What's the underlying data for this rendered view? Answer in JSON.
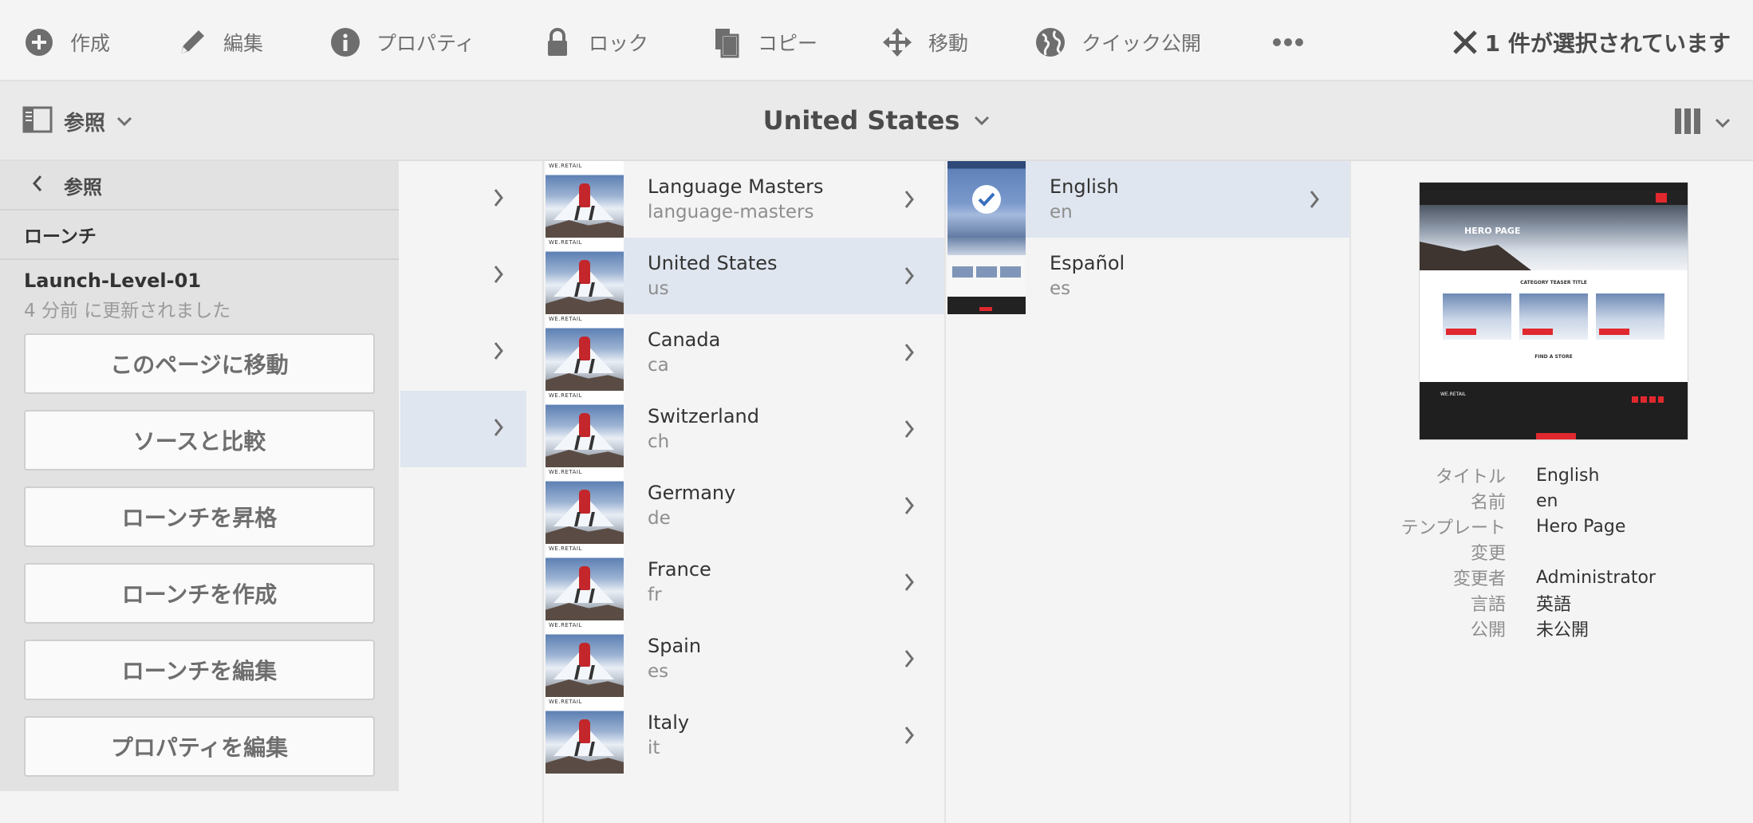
{
  "actionbar": {
    "actions": [
      {
        "label": "作成",
        "icon": "add-circle-icon"
      },
      {
        "label": "編集",
        "icon": "pencil-icon"
      },
      {
        "label": "プロパティ",
        "icon": "info-icon"
      },
      {
        "label": "ロック",
        "icon": "lock-icon"
      },
      {
        "label": "コピー",
        "icon": "copy-icon"
      },
      {
        "label": "移動",
        "icon": "move-icon"
      },
      {
        "label": "クイック公開",
        "icon": "globe-icon"
      },
      {
        "label": "",
        "icon": "more-icon"
      }
    ],
    "selection_text": "1 件が選択されています"
  },
  "subbar": {
    "rail_label": "参照",
    "title": "United States"
  },
  "rail": {
    "back_label": "参照",
    "section": "ローンチ",
    "launch_name": "Launch-Level-01",
    "launch_updated": "4 分前 に更新されました",
    "buttons": [
      "このページに移動",
      "ソースと比較",
      "ローンチを昇格",
      "ローンチを作成",
      "ローンチを編集",
      "プロパティを編集"
    ]
  },
  "column2": {
    "items": [
      {
        "title": "Language Masters",
        "name": "language-masters"
      },
      {
        "title": "United States",
        "name": "us",
        "selected": true
      },
      {
        "title": "Canada",
        "name": "ca"
      },
      {
        "title": "Switzerland",
        "name": "ch"
      },
      {
        "title": "Germany",
        "name": "de"
      },
      {
        "title": "France",
        "name": "fr"
      },
      {
        "title": "Spain",
        "name": "es"
      },
      {
        "title": "Italy",
        "name": "it"
      }
    ],
    "thumb_brand": "WE.RETAIL"
  },
  "column3": {
    "items": [
      {
        "title": "English",
        "name": "en",
        "selected": true
      },
      {
        "title": "Español",
        "name": "es"
      }
    ]
  },
  "preview": {
    "hero_text": "HERO PAGE",
    "category_text": "CATEGORY TEASER TITLE",
    "store_text": "FIND A STORE",
    "footer_brand": "WE.RETAIL",
    "meta": [
      {
        "key": "タイトル",
        "value": "English"
      },
      {
        "key": "名前",
        "value": "en"
      },
      {
        "key": "テンプレート",
        "value": "Hero Page"
      },
      {
        "key": "変更",
        "value": ""
      },
      {
        "key": "変更者",
        "value": "Administrator"
      },
      {
        "key": "言語",
        "value": "英語"
      },
      {
        "key": "公開",
        "value": "未公開"
      }
    ]
  },
  "colors": {
    "selection": "#e0e6ef",
    "accent_red": "#e0282e",
    "text": "#4b4b4b",
    "muted": "#8e8e8e"
  }
}
